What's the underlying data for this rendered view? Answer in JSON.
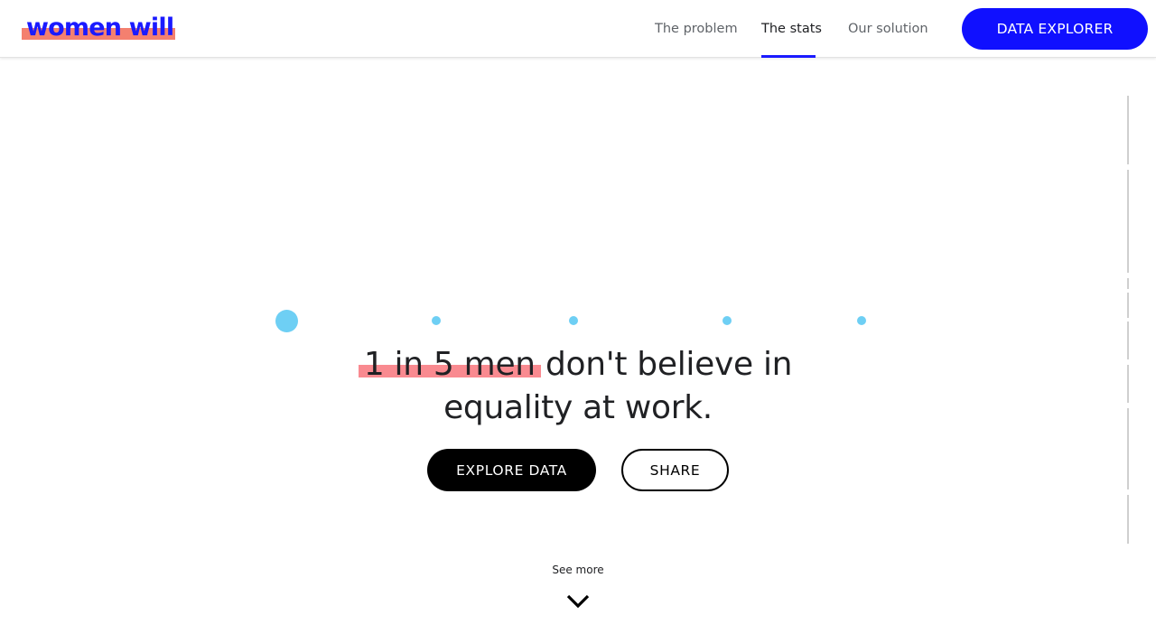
{
  "header": {
    "logo_text": "women will",
    "nav": [
      {
        "label": "The problem",
        "active": false
      },
      {
        "label": "The stats",
        "active": true
      },
      {
        "label": "Our solution",
        "active": false
      }
    ],
    "cta_label": "DATA EXPLORER"
  },
  "hero": {
    "highlight": "1 in 5 men",
    "headline_rest_1": " don't believe in",
    "headline_line_2": "equality at work.",
    "explore_label": "EXPLORE DATA",
    "share_label": "SHARE",
    "step_count": 5,
    "active_step": 1
  },
  "footer": {
    "see_more_label": "See more"
  },
  "colors": {
    "brand_blue": "#1a1aff",
    "logo_highlight": "#f4806f",
    "text_highlight": "#f98a90",
    "dot_blue": "#6ecff4",
    "button_black": "#000000"
  }
}
